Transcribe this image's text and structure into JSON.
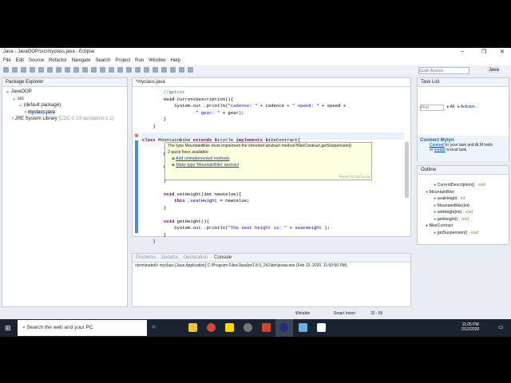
{
  "window": {
    "title": "Java - JavaOOP/src/myclass.java - Eclipse",
    "minimize": "–",
    "maximize": "❐",
    "close": "✕"
  },
  "menu": [
    "File",
    "Edit",
    "Source",
    "Refactor",
    "Navigate",
    "Search",
    "Project",
    "Run",
    "Window",
    "Help"
  ],
  "quick_access": {
    "placeholder": "Quick Access"
  },
  "perspective": "Java",
  "package_explorer": {
    "title": "Package Explorer",
    "items": [
      "JavaOOP",
      "src",
      "(default package)",
      "myclass.java",
      "JRE System Library"
    ],
    "jre_tag": "[CDC-1.1/Foundation-1.1]"
  },
  "editor": {
    "tab": "*myclass.java",
    "lines": [
      [
        "cm",
        "        //getter"
      ],
      [
        "kw",
        "        void ",
        "",
        "CurrentDescription(){"
      ],
      [
        "",
        "            System.",
        "fld",
        "out",
        "",
        " .println(",
        "str",
        "\"cadence: \"",
        "",
        " + cadence + ",
        "str",
        "\" speed: \"",
        "",
        " + speed +"
      ],
      [
        "str",
        "                    \" gear: \"",
        "",
        " + gear);"
      ],
      [
        "",
        "        }"
      ],
      [
        "",
        "    }"
      ],
      [
        "",
        ""
      ],
      [
        "kw",
        "class ",
        "",
        "MountainBike ",
        "kw",
        "extends ",
        "",
        "Bicycle ",
        "kw",
        "implements ",
        "",
        "BikeContract{"
      ],
      [
        "",
        "        //"
      ],
      [
        "",
        "        pr"
      ],
      [
        "",
        ""
      ],
      [
        "",
        "        Mo"
      ],
      [
        "",
        ""
      ],
      [
        "",
        "        }"
      ],
      [
        "",
        ""
      ],
      [
        "kw",
        "        void ",
        "",
        "setHeight(",
        "kw",
        "int ",
        "",
        "newValue){"
      ],
      [
        "kw",
        "            this",
        "",
        " .",
        "fld",
        "seatHeight",
        "",
        " = newValue;"
      ],
      [
        "",
        "        }"
      ],
      [
        "",
        ""
      ],
      [
        "kw",
        "        void ",
        "",
        "getHeight(){"
      ],
      [
        "",
        "            System.",
        "fld",
        "out",
        "",
        " .println(",
        "str",
        "\"The seat height is: \"",
        "",
        " + ",
        "fld",
        "seatHeight",
        "",
        " );"
      ],
      [
        "",
        "        }"
      ],
      [
        "",
        "    }"
      ]
    ]
  },
  "quickfix": {
    "message": "The type MountainBike must implement the inherited abstract method BikeContract.getSuspension()",
    "count": "2 quick fixes available:",
    "fixes": [
      "Add unimplemented methods",
      "Make type 'MountainBike' abstract"
    ],
    "footer": "Press 'F2' for focus"
  },
  "bottom_tabs": [
    "Problems",
    "Javadoc",
    "Declaration",
    "Console"
  ],
  "console": {
    "status": "<terminated> myclass [Java Application] C:\\Program Files\\Java\\jre1.8.0_241\\bin\\javaw.exe (Feb 12, 2020, 11:00:56 PM)"
  },
  "task_list": {
    "title": "Task List",
    "find_placeholder": "Find",
    "all": "All",
    "activate": "Activate..."
  },
  "mylyn": {
    "title": "Connect Mylyn",
    "connect": "Connect",
    "text1": " to your task and ALM tools",
    "or": "or ",
    "create": "create",
    "text2": " a local task."
  },
  "outline": {
    "title": "Outline",
    "items": [
      {
        "label": "CurrentDescription()",
        "type": " : void",
        "indent": 2,
        "color": "#2a6"
      },
      {
        "label": "MountainBike",
        "type": "",
        "indent": 1,
        "color": "#38a"
      },
      {
        "label": "seatHeight",
        "type": " : int",
        "indent": 2,
        "color": "#c55"
      },
      {
        "label": "MountainBike(int)",
        "type": "",
        "indent": 2,
        "color": "#2a6"
      },
      {
        "label": "setHeight(int)",
        "type": " : void",
        "indent": 2,
        "color": "#2a6"
      },
      {
        "label": "getHeight()",
        "type": " : void",
        "indent": 2,
        "color": "#2a6"
      },
      {
        "label": "BikeContract",
        "type": "",
        "indent": 1,
        "color": "#36a"
      },
      {
        "label": "getSuspension()",
        "type": " : void",
        "indent": 2,
        "color": "#2a6"
      }
    ]
  },
  "status_bar": {
    "writable": "Writable",
    "insert": "Smart Insert",
    "position": "32 : 59"
  },
  "taskbar": {
    "search": "Search the web and your PC",
    "time": "11:05 PM",
    "date": "2/12/2020"
  }
}
